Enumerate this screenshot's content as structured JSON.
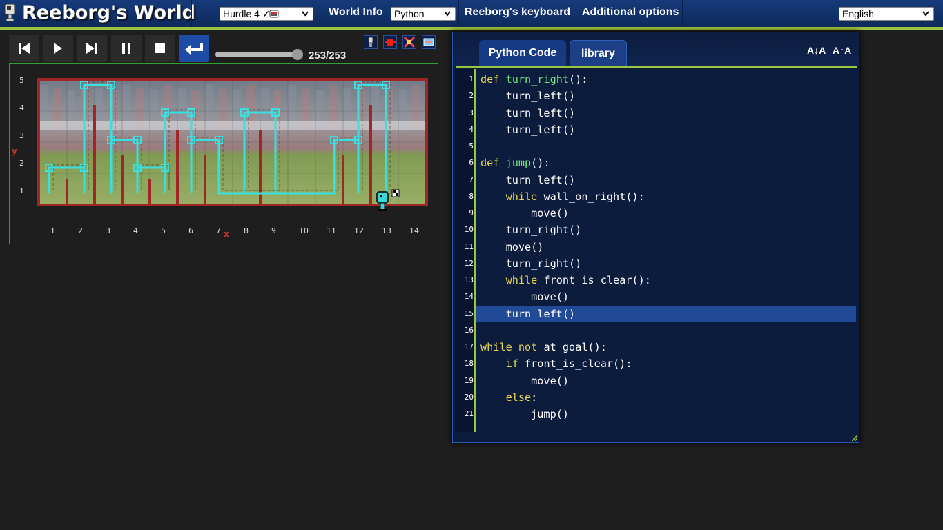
{
  "header": {
    "title": "Reeborg's World",
    "world_select": "Hurdle 4 ✓",
    "world_info": "World Info",
    "language_select": "Python",
    "keyboard": "Reeborg's keyboard",
    "additional": "Additional options",
    "ui_language": "English"
  },
  "controls": {
    "buttons": [
      "reload-icon",
      "run-icon",
      "step-icon",
      "pause-icon",
      "stop-icon",
      "return-icon"
    ],
    "step_counter": "253/253",
    "progress": 1.0
  },
  "world": {
    "y_axis_label": "y",
    "x_axis_label": "x",
    "x_ticks": [
      "1",
      "2",
      "3",
      "4",
      "5",
      "6",
      "7",
      "8",
      "9",
      "10",
      "11",
      "12",
      "13",
      "14"
    ],
    "y_ticks": [
      "1",
      "2",
      "3",
      "4",
      "5"
    ]
  },
  "editor": {
    "tab_code": "Python Code",
    "tab_library": "library",
    "font_decrease": "A↓A",
    "font_increase": "A↑A",
    "highlighted_line": 15,
    "lines": [
      [
        [
          "kw",
          "def "
        ],
        [
          "fn",
          "turn_right"
        ],
        [
          "",
          "():"
        ]
      ],
      [
        [
          "",
          "    turn_left()"
        ]
      ],
      [
        [
          "",
          "    turn_left()"
        ]
      ],
      [
        [
          "",
          "    turn_left()"
        ]
      ],
      [],
      [
        [
          "kw",
          "def "
        ],
        [
          "fn",
          "jump"
        ],
        [
          "",
          "():"
        ]
      ],
      [
        [
          "",
          "    turn_left()"
        ]
      ],
      [
        [
          "",
          "    "
        ],
        [
          "kw",
          "while "
        ],
        [
          "",
          "wall_on_right():"
        ]
      ],
      [
        [
          "",
          "        move()"
        ]
      ],
      [
        [
          "",
          "    turn_right()"
        ]
      ],
      [
        [
          "",
          "    move()"
        ]
      ],
      [
        [
          "",
          "    turn_right()"
        ]
      ],
      [
        [
          "",
          "    "
        ],
        [
          "kw",
          "while "
        ],
        [
          "",
          "front_is_clear():"
        ]
      ],
      [
        [
          "",
          "        move()"
        ]
      ],
      [
        [
          "",
          "    turn_left()"
        ]
      ],
      [],
      [
        [
          "kw",
          "while "
        ],
        [
          "kw",
          "not "
        ],
        [
          "",
          "at_goal():"
        ]
      ],
      [
        [
          "",
          "    "
        ],
        [
          "kw",
          "if "
        ],
        [
          "",
          "front_is_clear():"
        ]
      ],
      [
        [
          "",
          "        move()"
        ]
      ],
      [
        [
          "",
          "    "
        ],
        [
          "kw",
          "else"
        ],
        [
          "",
          ":"
        ]
      ],
      [
        [
          "",
          "        jump()"
        ]
      ]
    ]
  }
}
